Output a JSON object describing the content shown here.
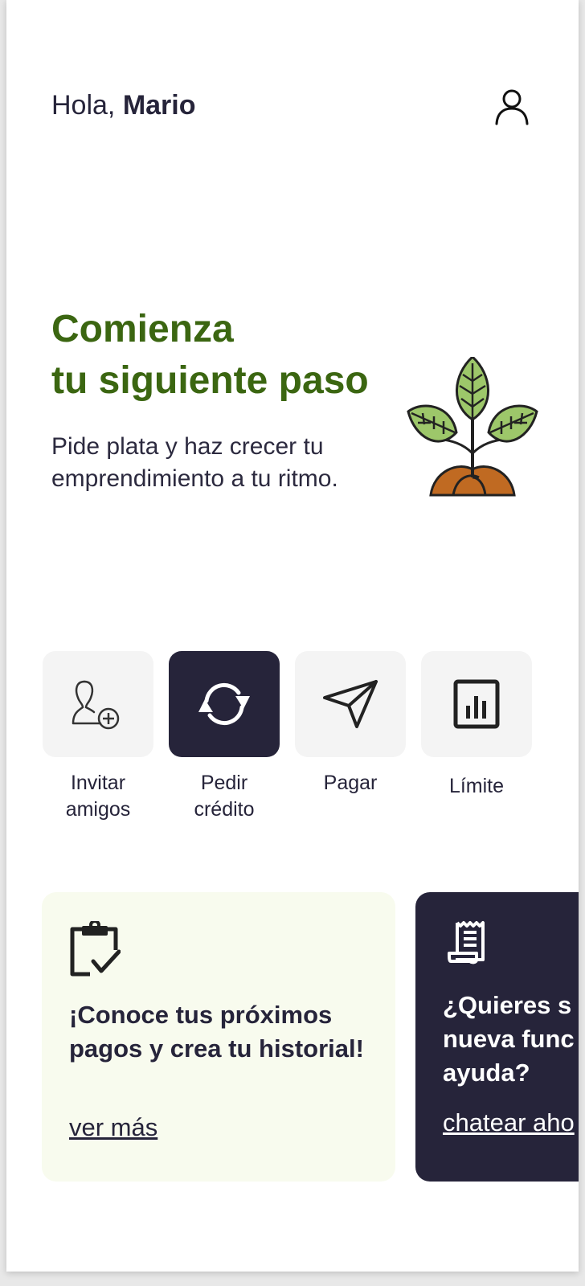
{
  "header": {
    "greeting": "Hola,",
    "user_name": "Mario"
  },
  "hero": {
    "title_line1": "Comienza",
    "title_line2": "tu siguiente paso",
    "subtitle_line1": "Pide plata y haz crecer tu",
    "subtitle_line2": "emprendimiento a tu ritmo."
  },
  "actions": [
    {
      "label_line1": "Invitar",
      "label_line2": "amigos",
      "icon": "add-user-icon"
    },
    {
      "label_line1": "Pedir",
      "label_line2": "crédito",
      "icon": "refresh-icon"
    },
    {
      "label_line1": "Pagar",
      "label_line2": "",
      "icon": "send-icon"
    },
    {
      "label_line1": "Límite",
      "label_line2": "",
      "icon": "bar-chart-icon"
    }
  ],
  "cards": [
    {
      "title": "¡Conoce tus próximos pagos y crea tu historial!",
      "link": "ver más",
      "icon": "clipboard-check-icon"
    },
    {
      "title_line1": "¿Quieres s",
      "title_line2": "nueva func",
      "title_line3": "ayuda?",
      "link": "chatear aho",
      "icon": "receipt-icon"
    }
  ],
  "colors": {
    "brand_green": "#3b6611",
    "dark": "#26243a",
    "tile_bg": "#f4f4f4",
    "card_light_bg": "#f8fbee"
  }
}
